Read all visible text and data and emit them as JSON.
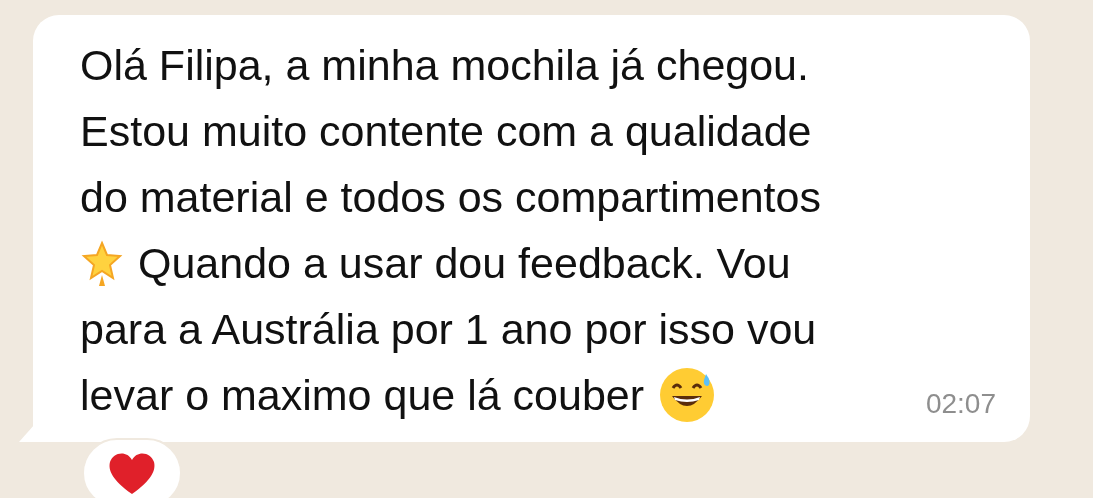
{
  "message": {
    "lines": [
      [
        {
          "kind": "text",
          "text": "Olá Filipa, a minha mochila já chegou."
        }
      ],
      [
        {
          "kind": "text",
          "text": "Estou muito contente com a qualidade"
        }
      ],
      [
        {
          "kind": "text",
          "text": "do material e todos os compartimentos"
        }
      ],
      [
        {
          "kind": "star"
        },
        {
          "kind": "text",
          "text": "Quando a usar dou feedback. Vou"
        }
      ],
      [
        {
          "kind": "text",
          "text": "para a Austrália por 1 ano por isso vou"
        }
      ],
      [
        {
          "kind": "text",
          "text": "levar o maximo que lá couber"
        },
        {
          "kind": "sweat"
        }
      ]
    ],
    "time": "02:07",
    "reactions": [
      {
        "kind": "heart"
      }
    ]
  }
}
